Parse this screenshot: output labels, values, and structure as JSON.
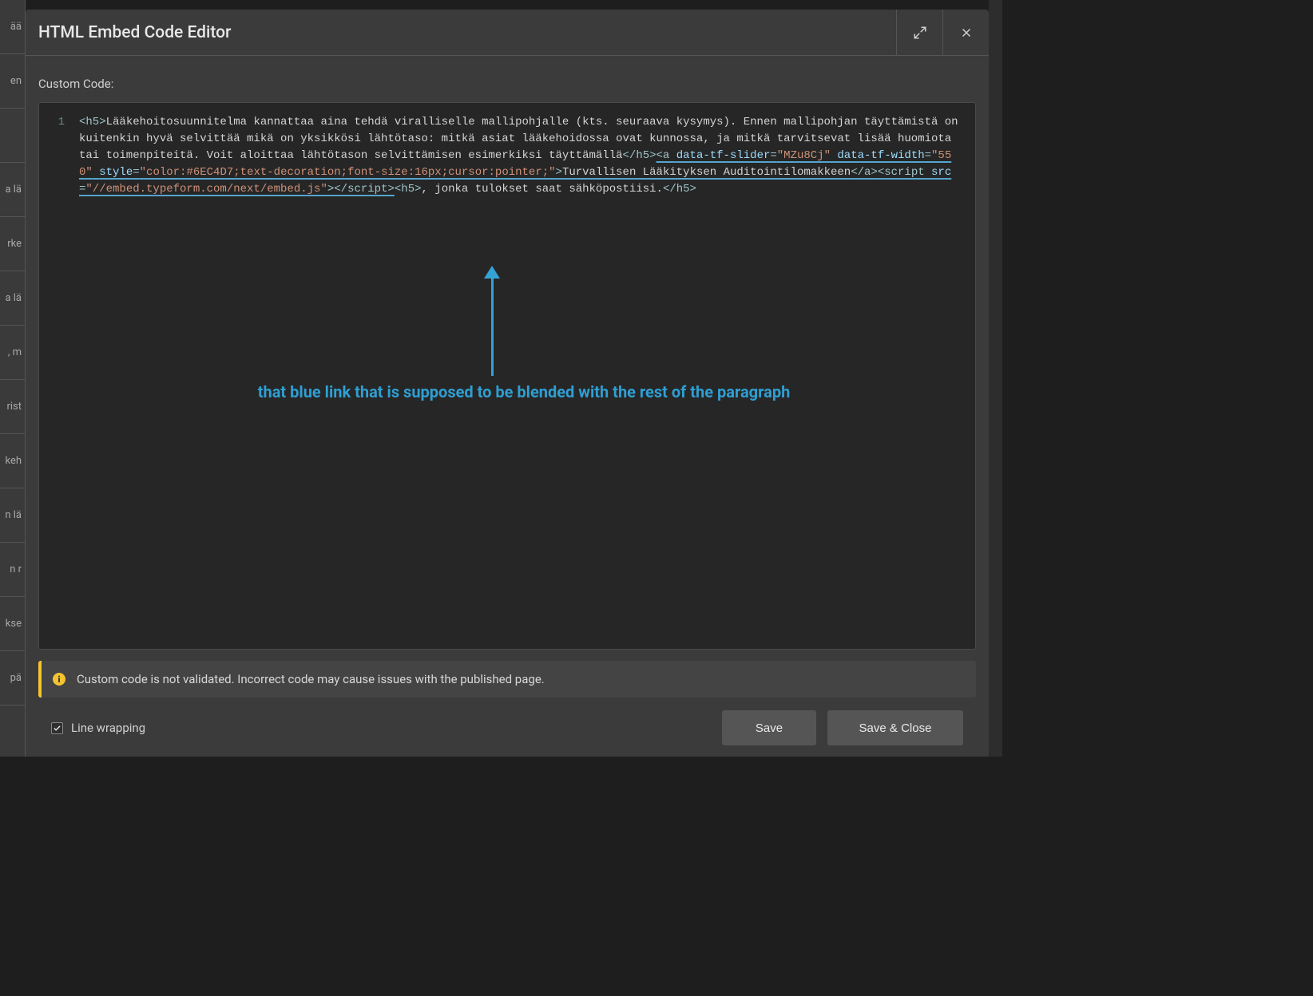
{
  "modal": {
    "title": "HTML Embed Code Editor",
    "field_label": "Custom Code:"
  },
  "code": {
    "line_number": "1",
    "tokens": {
      "h5_open": "<h5>",
      "text1": "Lääkehoitosuunnitelma kannattaa aina tehdä viralliselle mallipohjalle (kts. seuraava kysymys). Ennen mallipohjan täyttämistä on kuitenkin hyvä selvittää mikä on yksikkösi lähtötaso: mitkä asiat lääkehoidossa ovat kunnossa, ja mitkä tarvitsevat lisää huomiota tai toimenpiteitä. Voit aloittaa lähtötason selvittämisen esimerkiksi täyttämällä",
      "h5_close": "</h5>",
      "a_open": "<a ",
      "attr1_name": "data-tf-slider",
      "attr1_val": "\"MZu8Cj\"",
      "attr2_name": "data-tf-width",
      "attr2_val": "\"550\"",
      "style_name": "style",
      "style_val": "\"color:#6EC4D7;text-decoration;font-size:16px;cursor:pointer;\"",
      "a_close_bracket": ">",
      "link_text": "Turvallisen Lääkityksen Auditointilomakkeen",
      "a_close": "</a>",
      "script_open": "<script ",
      "src_name": "src",
      "src_val": "\"//embed.typeform.com/next/embed.js\"",
      "script_close": "></scr",
      "script_close2": "ipt>",
      "h5_open2": "<h5>",
      "text2": ", jonka tulokset saat sähköpostiisi.",
      "h5_close2": "</h5>"
    }
  },
  "annotation": {
    "text": "that blue link that is supposed to be blended with the rest of the paragraph"
  },
  "warning": {
    "message": "Custom code is not validated. Incorrect code may cause issues with the published page."
  },
  "footer": {
    "line_wrapping_label": "Line wrapping",
    "line_wrapping_checked": true,
    "save_label": "Save",
    "save_close_label": "Save & Close"
  },
  "bg_cells": [
    "ää",
    "en",
    "",
    "a lä",
    "rke",
    "a lä",
    ", m",
    "rist",
    "keh",
    "n lä",
    "n r",
    "kse",
    "pä"
  ]
}
